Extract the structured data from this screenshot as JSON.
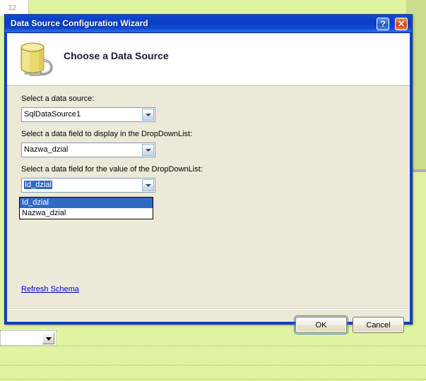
{
  "background": {
    "gutter_line_number": "12",
    "ddl_control_name": "dropdownlist-control"
  },
  "dialog": {
    "title": "Data Source Configuration Wizard",
    "help_button_glyph": "?",
    "close_button_glyph": "✕",
    "banner": {
      "heading": "Choose a Data Source",
      "icon": "database-plug-icon"
    },
    "fields": [
      {
        "label": "Select a data source:",
        "value": "SqlDataSource1",
        "name": "data-source-combo"
      },
      {
        "label": "Select a data field to display in the DropDownList:",
        "value": "Nazwa_dzial",
        "name": "display-field-combo"
      },
      {
        "label": "Select a data field for the value of the DropDownList:",
        "value": "Id_dzial",
        "name": "value-field-combo"
      }
    ],
    "dropdown_open": {
      "items": [
        "Id_dzial",
        "Nazwa_dzial"
      ],
      "highlighted_index": 0
    },
    "refresh_link": "Refresh Schema",
    "buttons": {
      "ok": "OK",
      "cancel": "Cancel"
    }
  },
  "colors": {
    "titlebar_blue": "#0c43cf",
    "dialog_face": "#ece9d8",
    "designer_green": "#dff3a0",
    "designer_green_alt": "#c9dd8d",
    "highlight_blue": "#316ac5",
    "link_blue": "#0000cd"
  }
}
